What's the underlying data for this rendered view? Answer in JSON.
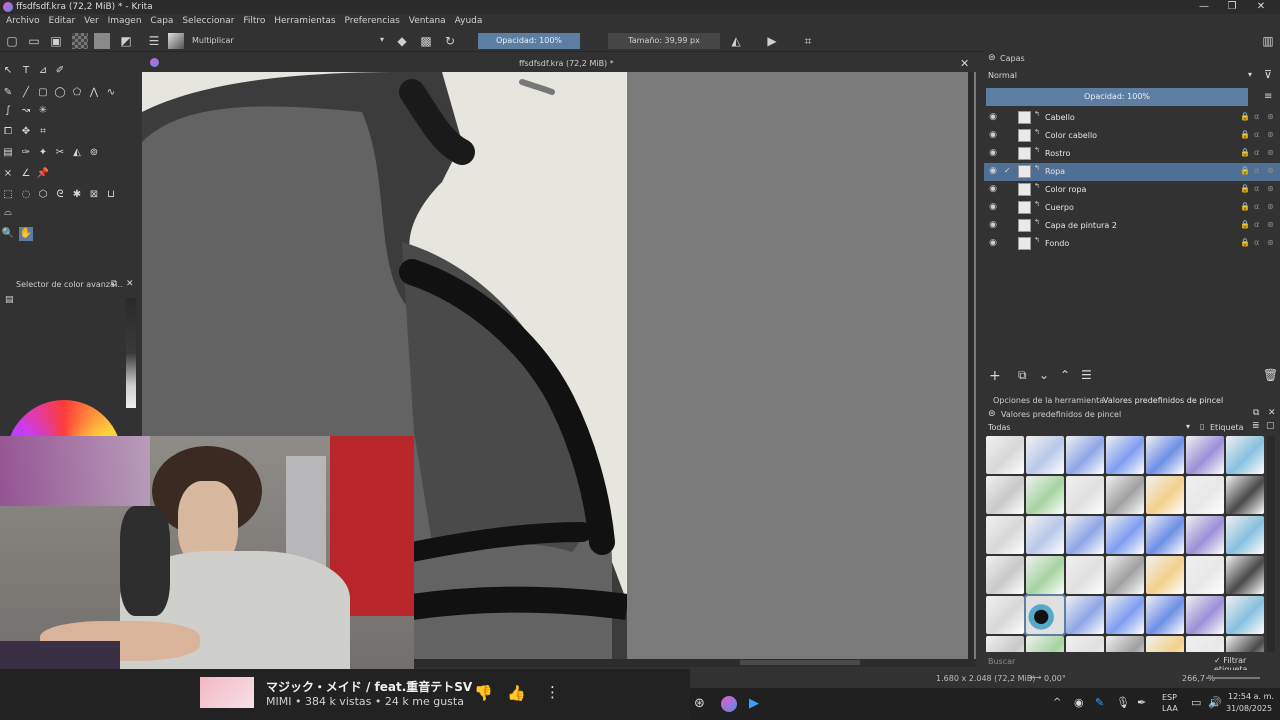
{
  "window": {
    "title": "ffsdfsdf.kra (72,2 MiB) * - Krita"
  },
  "menu": [
    "Archivo",
    "Editar",
    "Ver",
    "Imagen",
    "Capa",
    "Seleccionar",
    "Filtro",
    "Herramientas",
    "Preferencias",
    "Ventana",
    "Ayuda"
  ],
  "toolbar": {
    "blend_mode": "Multiplicar",
    "opacity": "Opacidad: 100%",
    "size": "Tamaño: 39,99 px"
  },
  "canvas": {
    "tab_title": "ffsdfsdf.kra (72,2 MiB) *"
  },
  "color_panel": {
    "title": "Selector de color avanza..."
  },
  "layers": {
    "title": "Capas",
    "blend": "Normal",
    "opacity": "Opacidad:  100%",
    "items": [
      {
        "name": "Cabello"
      },
      {
        "name": "Color cabello"
      },
      {
        "name": "Rostro"
      },
      {
        "name": "Ropa",
        "selected": true
      },
      {
        "name": "Color ropa"
      },
      {
        "name": "Cuerpo"
      },
      {
        "name": "Capa de pintura 2"
      },
      {
        "name": "Fondo"
      }
    ]
  },
  "presets": {
    "tab_tool_options": "Opciones de la herramienta",
    "tab_brush_presets": "Valores predefinidos de pincel",
    "title": "Valores predefinidos de pincel",
    "filter_all": "Todas",
    "tag_label": "Etiqueta",
    "search_placeholder": "Buscar",
    "filter_tag": "Filtrar etiqueta"
  },
  "status": {
    "dimensions": "1.680 x 2.048 (72,2 MiB)",
    "rotation": "0,00°",
    "zoom": "266,7 %"
  },
  "youtube": {
    "song": "マジック・メイド / feat.重音テトSV",
    "meta": "MIMI • 384 k vistas • 24 k me gusta"
  },
  "tray": {
    "lang1": "ESP",
    "lang2": "LAA",
    "time": "12:54 a. m.",
    "date": "31/08/2025"
  }
}
